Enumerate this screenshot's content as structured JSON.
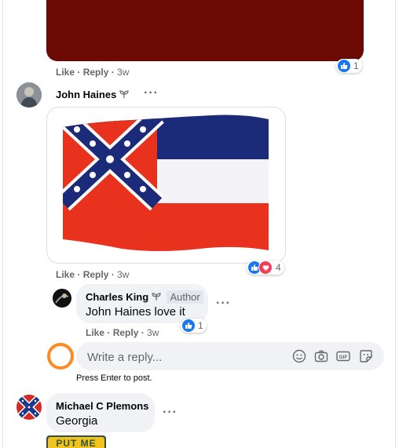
{
  "top_comment": {
    "actions": {
      "like": "Like",
      "reply": "Reply",
      "time": "3w"
    },
    "reactions": {
      "count": "1"
    }
  },
  "comment_john": {
    "author": "John Haines",
    "more": "···",
    "actions": {
      "like": "Like",
      "reply": "Reply",
      "time": "3w"
    },
    "reactions": {
      "count": "4"
    }
  },
  "reply_charles": {
    "author": "Charles King",
    "badge": "Author",
    "mention": "John Haines",
    "text": " love it",
    "more": "···",
    "actions": {
      "like": "Like",
      "reply": "Reply",
      "time": "3w"
    },
    "reactions": {
      "count": "1"
    }
  },
  "reply_box": {
    "placeholder": "Write a reply...",
    "hint": "Press Enter to post.",
    "tools": [
      "emoji-icon",
      "camera-icon",
      "gif-icon",
      "sticker-icon"
    ]
  },
  "comment_michael": {
    "author": "Michael C Plemons",
    "text": "Georgia",
    "more": "···",
    "sticker_text": "PUT ME"
  },
  "colors": {
    "like_blue": "#1877f2",
    "love_red": "#f33e58",
    "bubble": "#f0f2f5",
    "muted": "#65676b",
    "ring": "#ff8a1f"
  }
}
